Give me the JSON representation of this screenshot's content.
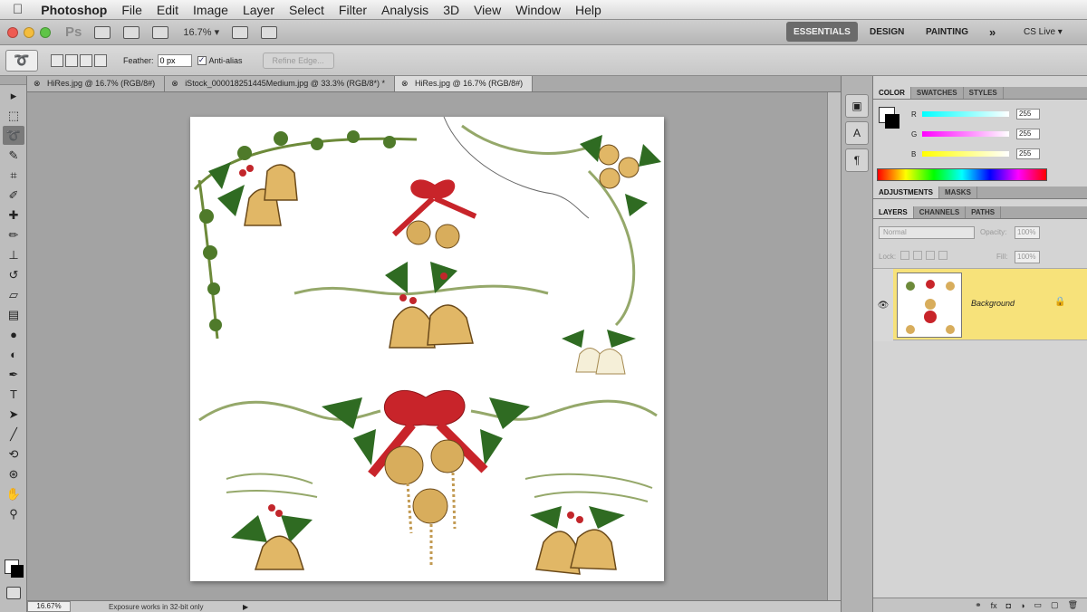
{
  "menubar": {
    "apple": "",
    "app": "Photoshop",
    "items": [
      "File",
      "Edit",
      "Image",
      "Layer",
      "Select",
      "Filter",
      "Analysis",
      "3D",
      "View",
      "Window",
      "Help"
    ]
  },
  "appbar": {
    "logo": "Ps",
    "zoom": "16.7% ▾",
    "workspaces": {
      "essentials": "ESSENTIALS",
      "design": "DESIGN",
      "painting": "PAINTING",
      "more": "»"
    },
    "cslive": "CS Live ▾"
  },
  "options": {
    "feather_label": "Feather:",
    "feather_value": "0 px",
    "antialias_label": "Anti-alias",
    "refine_edge": "Refine Edge..."
  },
  "tabs": [
    {
      "label": "HiRes.jpg @ 16.7% (RGB/8#)",
      "active": false
    },
    {
      "label": "iStock_000018251445Medium.jpg @ 33.3% (RGB/8*) *",
      "active": false
    },
    {
      "label": "HiRes.jpg @ 16.7% (RGB/8#)",
      "active": true
    }
  ],
  "status": {
    "zoom": "16.67%",
    "message": "Exposure works in 32-bit only"
  },
  "color_panel": {
    "tabs": [
      "COLOR",
      "SWATCHES",
      "STYLES"
    ],
    "r_label": "R",
    "r_value": "255",
    "g_label": "G",
    "g_value": "255",
    "b_label": "B",
    "b_value": "255"
  },
  "adjust_tabs": [
    "ADJUSTMENTS",
    "MASKS"
  ],
  "layers_panel": {
    "tabs": [
      "LAYERS",
      "CHANNELS",
      "PATHS"
    ],
    "blend_mode": "Normal",
    "opacity_label": "Opacity:",
    "opacity_value": "100%",
    "lock_label": "Lock:",
    "fill_label": "Fill:",
    "fill_value": "100%",
    "layer_name": "Background"
  }
}
